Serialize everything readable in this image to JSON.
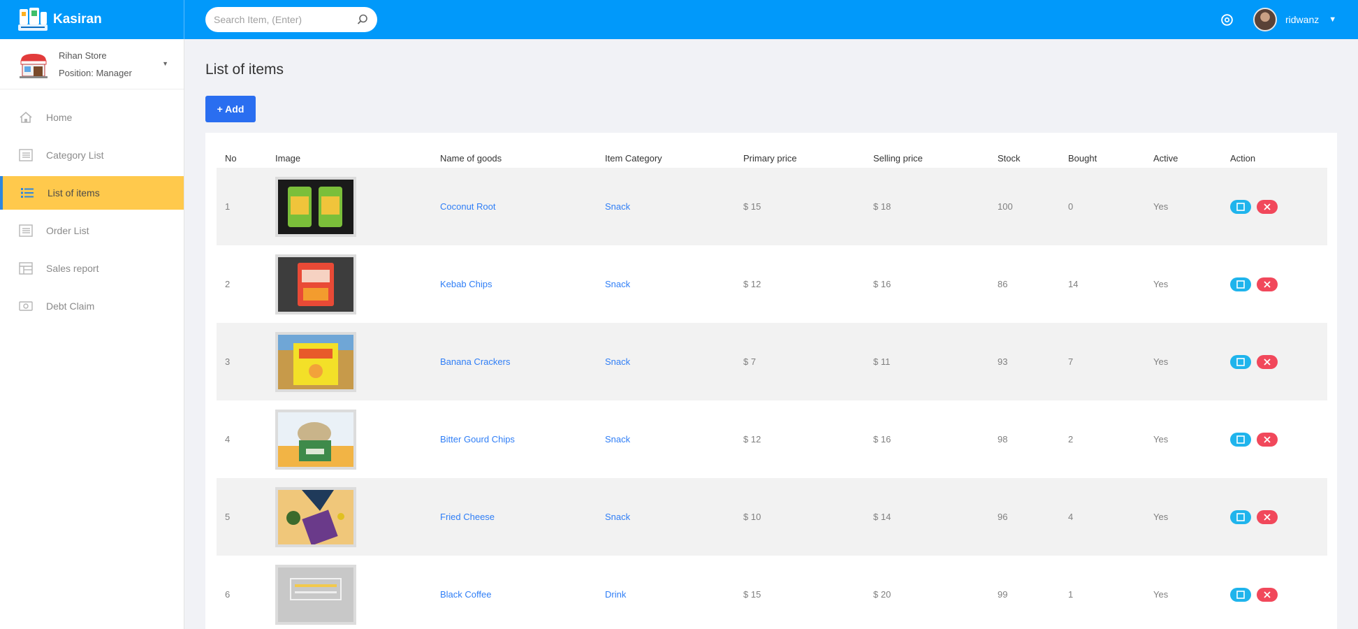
{
  "app": {
    "name": "Kasiran"
  },
  "search": {
    "placeholder": "Search Item, (Enter)"
  },
  "user": {
    "name": "ridwanz"
  },
  "store": {
    "name": "Rihan Store",
    "position": "Position: Manager"
  },
  "sidebar": {
    "items": [
      {
        "label": "Home",
        "icon": "home-icon",
        "active": false
      },
      {
        "label": "Category List",
        "icon": "list-icon",
        "active": false
      },
      {
        "label": "List of items",
        "icon": "list-icon",
        "active": true
      },
      {
        "label": "Order List",
        "icon": "list-icon",
        "active": false
      },
      {
        "label": "Sales report",
        "icon": "report-icon",
        "active": false
      },
      {
        "label": "Debt Claim",
        "icon": "money-icon",
        "active": false
      }
    ]
  },
  "main": {
    "title": "List of items",
    "add_label": "+ Add"
  },
  "table": {
    "columns": [
      "No",
      "Image",
      "Name of goods",
      "Item Category",
      "Primary price",
      "Selling price",
      "Stock",
      "Bought",
      "Active",
      "Action"
    ],
    "rows": [
      {
        "no": "1",
        "name": "Coconut Root",
        "category": "Snack",
        "primary": "$ 15",
        "selling": "$ 18",
        "stock": "100",
        "bought": "0",
        "active": "Yes",
        "image": "coconut-root-thumbnail"
      },
      {
        "no": "2",
        "name": "Kebab Chips",
        "category": "Snack",
        "primary": "$ 12",
        "selling": "$ 16",
        "stock": "86",
        "bought": "14",
        "active": "Yes",
        "image": "kebab-chips-thumbnail"
      },
      {
        "no": "3",
        "name": "Banana Crackers",
        "category": "Snack",
        "primary": "$ 7",
        "selling": "$ 11",
        "stock": "93",
        "bought": "7",
        "active": "Yes",
        "image": "banana-crackers-thumbnail"
      },
      {
        "no": "4",
        "name": "Bitter Gourd Chips",
        "category": "Snack",
        "primary": "$ 12",
        "selling": "$ 16",
        "stock": "98",
        "bought": "2",
        "active": "Yes",
        "image": "bitter-gourd-chips-thumbnail"
      },
      {
        "no": "5",
        "name": "Fried Cheese",
        "category": "Snack",
        "primary": "$ 10",
        "selling": "$ 14",
        "stock": "96",
        "bought": "4",
        "active": "Yes",
        "image": "fried-cheese-thumbnail"
      },
      {
        "no": "6",
        "name": "Black Coffee",
        "category": "Drink",
        "primary": "$ 15",
        "selling": "$ 20",
        "stock": "99",
        "bought": "1",
        "active": "Yes",
        "image": "black-coffee-thumbnail"
      }
    ]
  },
  "colors": {
    "topbar": "#0199fa",
    "active_menu": "#ffc94c",
    "add_button": "#2a6ef0",
    "edit_button": "#1fb4ec",
    "delete_button": "#f1485b",
    "link": "#2f7ef6"
  }
}
